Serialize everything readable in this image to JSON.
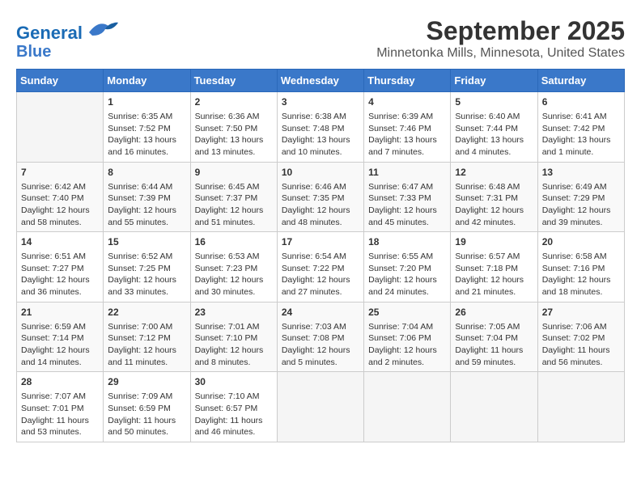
{
  "header": {
    "logo": {
      "line1": "General",
      "line2": "Blue"
    },
    "title": "September 2025",
    "subtitle": "Minnetonka Mills, Minnesota, United States"
  },
  "weekdays": [
    "Sunday",
    "Monday",
    "Tuesday",
    "Wednesday",
    "Thursday",
    "Friday",
    "Saturday"
  ],
  "weeks": [
    [
      {
        "day": "",
        "sunrise": "",
        "sunset": "",
        "daylight": ""
      },
      {
        "day": "1",
        "sunrise": "Sunrise: 6:35 AM",
        "sunset": "Sunset: 7:52 PM",
        "daylight": "Daylight: 13 hours and 16 minutes."
      },
      {
        "day": "2",
        "sunrise": "Sunrise: 6:36 AM",
        "sunset": "Sunset: 7:50 PM",
        "daylight": "Daylight: 13 hours and 13 minutes."
      },
      {
        "day": "3",
        "sunrise": "Sunrise: 6:38 AM",
        "sunset": "Sunset: 7:48 PM",
        "daylight": "Daylight: 13 hours and 10 minutes."
      },
      {
        "day": "4",
        "sunrise": "Sunrise: 6:39 AM",
        "sunset": "Sunset: 7:46 PM",
        "daylight": "Daylight: 13 hours and 7 minutes."
      },
      {
        "day": "5",
        "sunrise": "Sunrise: 6:40 AM",
        "sunset": "Sunset: 7:44 PM",
        "daylight": "Daylight: 13 hours and 4 minutes."
      },
      {
        "day": "6",
        "sunrise": "Sunrise: 6:41 AM",
        "sunset": "Sunset: 7:42 PM",
        "daylight": "Daylight: 13 hours and 1 minute."
      }
    ],
    [
      {
        "day": "7",
        "sunrise": "Sunrise: 6:42 AM",
        "sunset": "Sunset: 7:40 PM",
        "daylight": "Daylight: 12 hours and 58 minutes."
      },
      {
        "day": "8",
        "sunrise": "Sunrise: 6:44 AM",
        "sunset": "Sunset: 7:39 PM",
        "daylight": "Daylight: 12 hours and 55 minutes."
      },
      {
        "day": "9",
        "sunrise": "Sunrise: 6:45 AM",
        "sunset": "Sunset: 7:37 PM",
        "daylight": "Daylight: 12 hours and 51 minutes."
      },
      {
        "day": "10",
        "sunrise": "Sunrise: 6:46 AM",
        "sunset": "Sunset: 7:35 PM",
        "daylight": "Daylight: 12 hours and 48 minutes."
      },
      {
        "day": "11",
        "sunrise": "Sunrise: 6:47 AM",
        "sunset": "Sunset: 7:33 PM",
        "daylight": "Daylight: 12 hours and 45 minutes."
      },
      {
        "day": "12",
        "sunrise": "Sunrise: 6:48 AM",
        "sunset": "Sunset: 7:31 PM",
        "daylight": "Daylight: 12 hours and 42 minutes."
      },
      {
        "day": "13",
        "sunrise": "Sunrise: 6:49 AM",
        "sunset": "Sunset: 7:29 PM",
        "daylight": "Daylight: 12 hours and 39 minutes."
      }
    ],
    [
      {
        "day": "14",
        "sunrise": "Sunrise: 6:51 AM",
        "sunset": "Sunset: 7:27 PM",
        "daylight": "Daylight: 12 hours and 36 minutes."
      },
      {
        "day": "15",
        "sunrise": "Sunrise: 6:52 AM",
        "sunset": "Sunset: 7:25 PM",
        "daylight": "Daylight: 12 hours and 33 minutes."
      },
      {
        "day": "16",
        "sunrise": "Sunrise: 6:53 AM",
        "sunset": "Sunset: 7:23 PM",
        "daylight": "Daylight: 12 hours and 30 minutes."
      },
      {
        "day": "17",
        "sunrise": "Sunrise: 6:54 AM",
        "sunset": "Sunset: 7:22 PM",
        "daylight": "Daylight: 12 hours and 27 minutes."
      },
      {
        "day": "18",
        "sunrise": "Sunrise: 6:55 AM",
        "sunset": "Sunset: 7:20 PM",
        "daylight": "Daylight: 12 hours and 24 minutes."
      },
      {
        "day": "19",
        "sunrise": "Sunrise: 6:57 AM",
        "sunset": "Sunset: 7:18 PM",
        "daylight": "Daylight: 12 hours and 21 minutes."
      },
      {
        "day": "20",
        "sunrise": "Sunrise: 6:58 AM",
        "sunset": "Sunset: 7:16 PM",
        "daylight": "Daylight: 12 hours and 18 minutes."
      }
    ],
    [
      {
        "day": "21",
        "sunrise": "Sunrise: 6:59 AM",
        "sunset": "Sunset: 7:14 PM",
        "daylight": "Daylight: 12 hours and 14 minutes."
      },
      {
        "day": "22",
        "sunrise": "Sunrise: 7:00 AM",
        "sunset": "Sunset: 7:12 PM",
        "daylight": "Daylight: 12 hours and 11 minutes."
      },
      {
        "day": "23",
        "sunrise": "Sunrise: 7:01 AM",
        "sunset": "Sunset: 7:10 PM",
        "daylight": "Daylight: 12 hours and 8 minutes."
      },
      {
        "day": "24",
        "sunrise": "Sunrise: 7:03 AM",
        "sunset": "Sunset: 7:08 PM",
        "daylight": "Daylight: 12 hours and 5 minutes."
      },
      {
        "day": "25",
        "sunrise": "Sunrise: 7:04 AM",
        "sunset": "Sunset: 7:06 PM",
        "daylight": "Daylight: 12 hours and 2 minutes."
      },
      {
        "day": "26",
        "sunrise": "Sunrise: 7:05 AM",
        "sunset": "Sunset: 7:04 PM",
        "daylight": "Daylight: 11 hours and 59 minutes."
      },
      {
        "day": "27",
        "sunrise": "Sunrise: 7:06 AM",
        "sunset": "Sunset: 7:02 PM",
        "daylight": "Daylight: 11 hours and 56 minutes."
      }
    ],
    [
      {
        "day": "28",
        "sunrise": "Sunrise: 7:07 AM",
        "sunset": "Sunset: 7:01 PM",
        "daylight": "Daylight: 11 hours and 53 minutes."
      },
      {
        "day": "29",
        "sunrise": "Sunrise: 7:09 AM",
        "sunset": "Sunset: 6:59 PM",
        "daylight": "Daylight: 11 hours and 50 minutes."
      },
      {
        "day": "30",
        "sunrise": "Sunrise: 7:10 AM",
        "sunset": "Sunset: 6:57 PM",
        "daylight": "Daylight: 11 hours and 46 minutes."
      },
      {
        "day": "",
        "sunrise": "",
        "sunset": "",
        "daylight": ""
      },
      {
        "day": "",
        "sunrise": "",
        "sunset": "",
        "daylight": ""
      },
      {
        "day": "",
        "sunrise": "",
        "sunset": "",
        "daylight": ""
      },
      {
        "day": "",
        "sunrise": "",
        "sunset": "",
        "daylight": ""
      }
    ]
  ]
}
